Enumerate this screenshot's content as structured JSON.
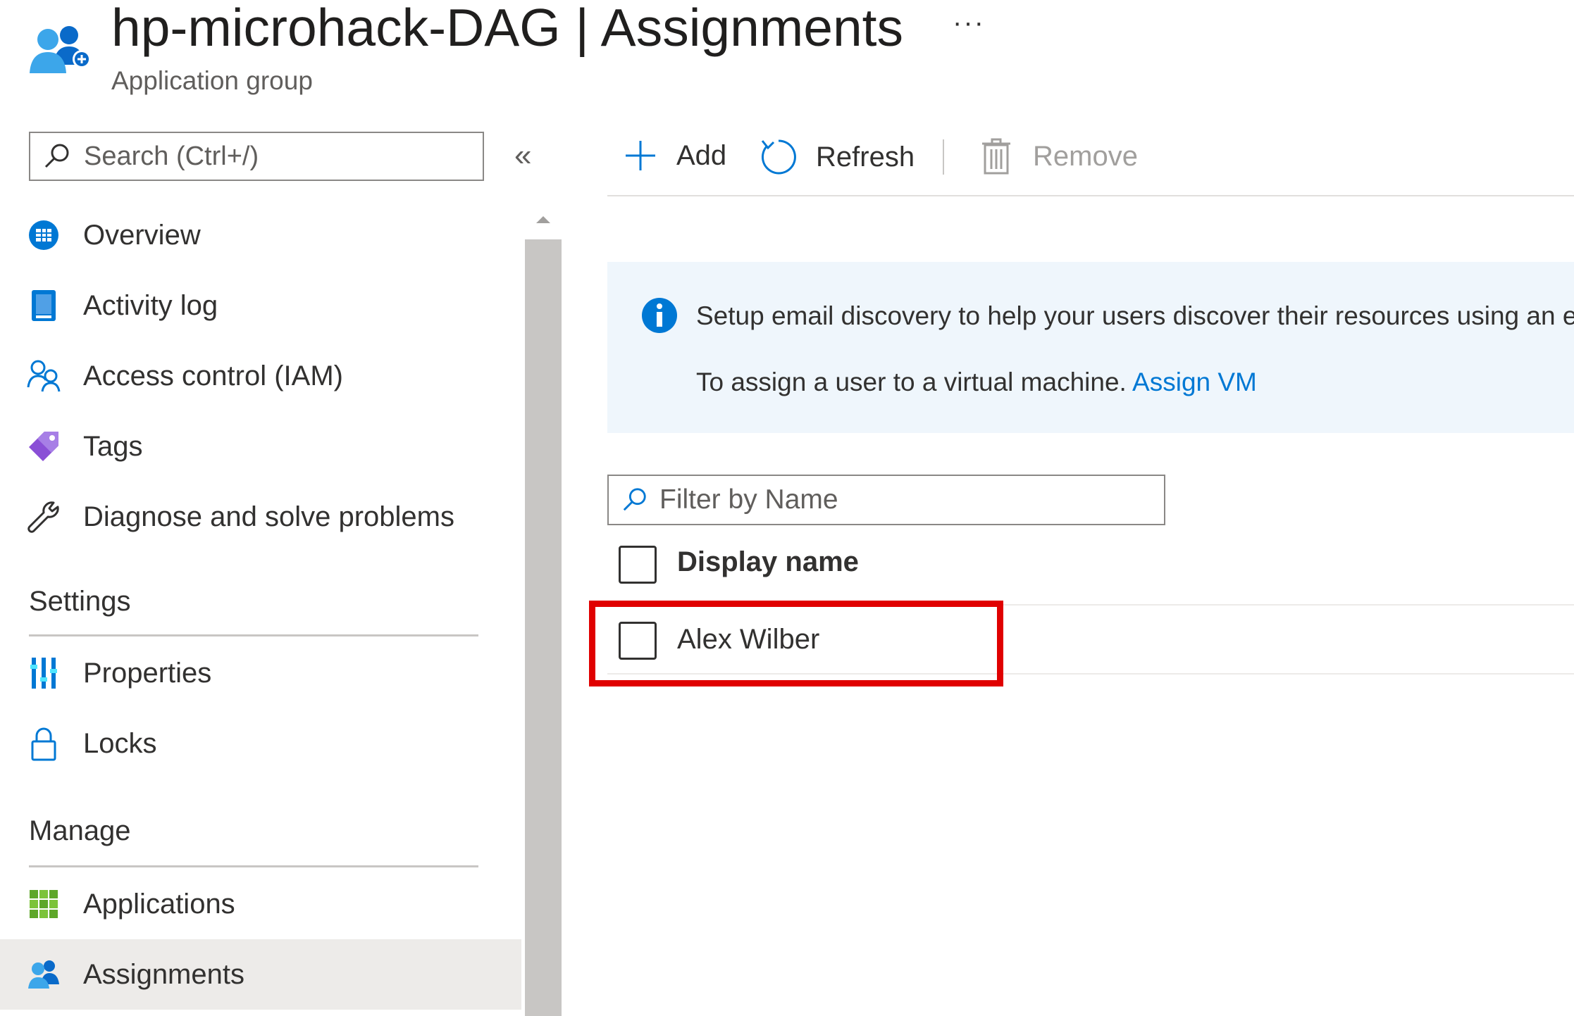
{
  "header": {
    "title": "hp-microhack-DAG | Assignments",
    "subtitle": "Application group",
    "more": "···",
    "icon": "users-group-icon"
  },
  "sidebar": {
    "search_placeholder": "Search (Ctrl+/)",
    "collapse": "«",
    "items": [
      {
        "label": "Overview",
        "icon": "overview-icon"
      },
      {
        "label": "Activity log",
        "icon": "activity-log-icon"
      },
      {
        "label": "Access control (IAM)",
        "icon": "iam-icon"
      },
      {
        "label": "Tags",
        "icon": "tag-icon"
      },
      {
        "label": "Diagnose and solve problems",
        "icon": "wrench-icon"
      }
    ],
    "settings": {
      "title": "Settings",
      "items": [
        {
          "label": "Properties",
          "icon": "properties-icon"
        },
        {
          "label": "Locks",
          "icon": "lock-icon"
        }
      ]
    },
    "manage": {
      "title": "Manage",
      "items": [
        {
          "label": "Applications",
          "icon": "applications-grid-icon"
        },
        {
          "label": "Assignments",
          "icon": "assignments-icon",
          "active": true
        }
      ]
    }
  },
  "toolbar": {
    "add": "Add",
    "refresh": "Refresh",
    "remove": "Remove"
  },
  "banner": {
    "line1": "Setup email discovery to help your users discover their resources using an er",
    "line2_text": "To assign a user to a virtual machine. ",
    "line2_link": "Assign VM"
  },
  "filter": {
    "placeholder": "Filter by Name"
  },
  "table": {
    "column": "Display name",
    "rows": [
      {
        "name": "Alex Wilber",
        "highlighted": true
      }
    ]
  },
  "colors": {
    "accent": "#0078d4",
    "highlight": "#e00000",
    "banner_bg": "#eff6fc"
  }
}
